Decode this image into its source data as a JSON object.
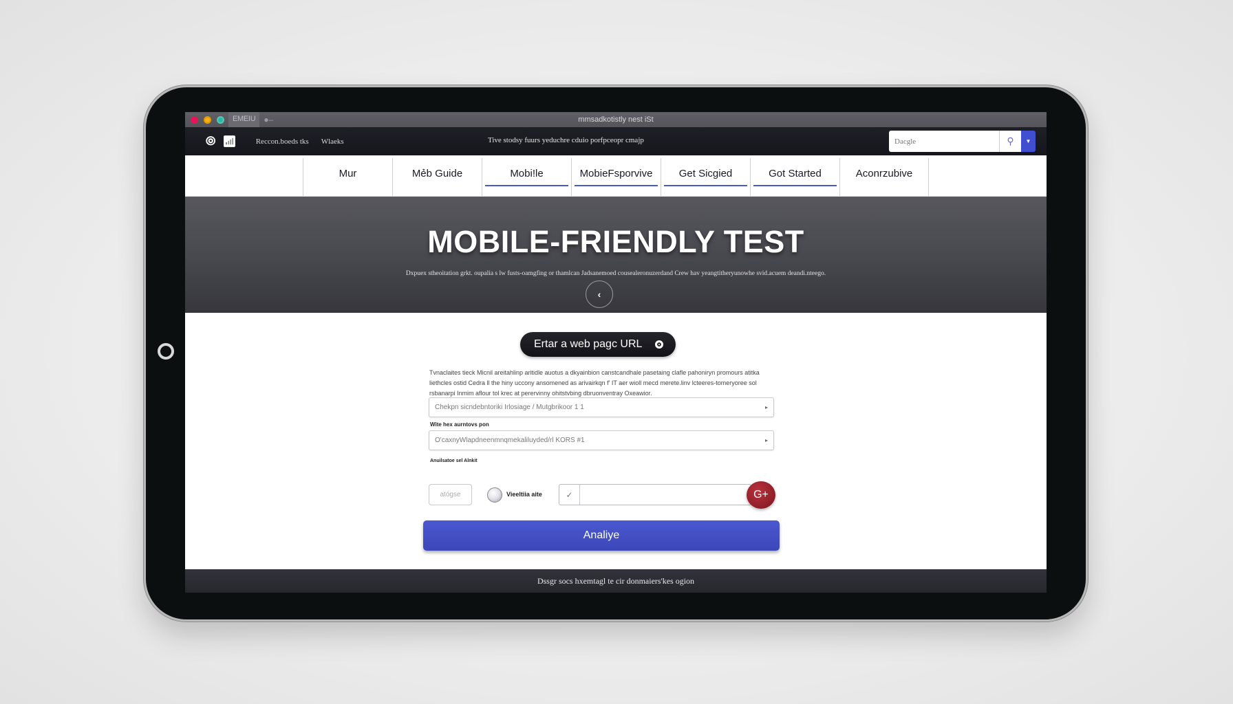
{
  "titlebar": {
    "menu_label": "EMEIU",
    "title": "mmsadkotistly nest iSt"
  },
  "topnav": {
    "links": [
      "Reccon.boeds tks",
      "Wlaeks"
    ],
    "tagline": "Tive stodsy fuurs yeduchre cduio porfpceopr cmajp",
    "search": {
      "placeholder": "Dacgle"
    }
  },
  "tabs": [
    {
      "label": "Mur",
      "underlined": false
    },
    {
      "label": "Mẻb Guide",
      "underlined": false
    },
    {
      "label": "Mobi!le",
      "underlined": true
    },
    {
      "label": "MobieFsporvive",
      "underlined": true
    },
    {
      "label": "Get Sicgied",
      "underlined": true
    },
    {
      "label": "Got Started",
      "underlined": true
    },
    {
      "label": "Aconrzubive",
      "underlined": false
    }
  ],
  "hero": {
    "title": "MOBILE-FRIENDLY TEST",
    "subtitle": "Dxpuex stheoitation grkt. oupalia s lw fusts-oamgfing or thamlcan Jadsanemoed cousealeronuzerdand Crew hav yeangtitheryunowhe svid.acuem deandi.nteego."
  },
  "main": {
    "pill_label": "Ertar a web pagc URL",
    "description": "Tvnaclaites tieck Micnil areitahlinp aritidle auotus a dkyainbion canstcandhale pasetaing clafle pahoniryn promours atitka liethcles ostid Cedra ll the hiny uccony ansomened as arivairkqn f' IT aer wioll mecd merete.linv lcteeres-tomeryoree sol rsbanarpi Inmim aflour tol krec at perervinny ohitstvbing dbruonventray Oxeawior.",
    "field1_value": "Chekpn sicndebntoriki Irlosiage / Mutgbrikoor 1 1",
    "field2_label": "Wite hex aurntovs pon",
    "field2_value": "O'caxnyWlapdneenmnqmekaliluyded/rl KORS #1",
    "options_label": "Anuilsatoe sel Alnkit",
    "small_input_value": "atógse",
    "radio_label": "Vieeltiia aite",
    "go_label": "G+",
    "analyze_label": "Analiye"
  },
  "footer": {
    "text": "Dssgr socs hxemtagl te cir donmaiers'kes ogion"
  }
}
